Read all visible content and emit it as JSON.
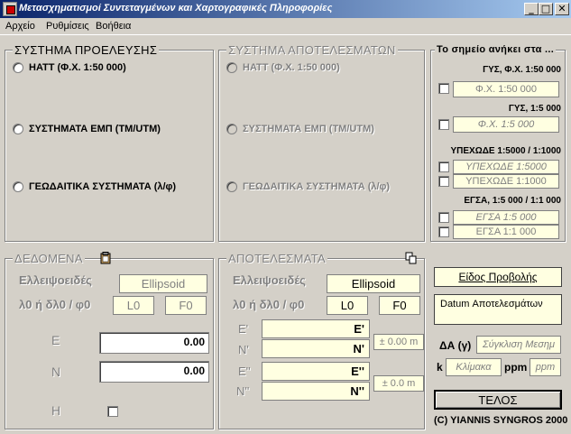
{
  "window": {
    "title": "Μετασχηματισμοί Συντεταγμένων και Χαρτογραφικές Πληροφορίες",
    "minimize": "_",
    "maximize": "□",
    "close": "✕"
  },
  "menu": [
    "Αρχείο",
    "Ρυθμίσεις",
    "Βοήθεια"
  ],
  "source_system": {
    "title": "ΣΥΣΤΗΜΑ ΠΡΟΕΛΕΥΣΗΣ",
    "options": [
      "ΗΑΤΤ (Φ.Χ. 1:50 000)",
      "ΣΥΣΤΗΜΑΤΑ ΕΜΠ (ΤΜ/UTM)",
      "ΓΕΩΔΑΙΤΙΚΑ ΣΥΣΤΗΜΑΤΑ (λ/φ)"
    ]
  },
  "result_system": {
    "title": "ΣΥΣΤΗΜΑ ΑΠΟΤΕΛΕΣΜΑΤΩΝ",
    "options": [
      "ΗΑΤΤ (Φ.Χ. 1:50 000)",
      "ΣΥΣΤΗΜΑΤΑ ΕΜΠ (ΤΜ/UTM)",
      "ΓΕΩΔΑΙΤΙΚΑ ΣΥΣΤΗΜΑΤΑ (λ/φ)"
    ]
  },
  "point_belongs": {
    "title": "Το σημείο ανήκει στα ...",
    "gys_50000_label": "ΓΥΣ, Φ.Χ. 1:50 000",
    "gys_50000_box": "Φ.Χ. 1:50 000",
    "gys_5000_label": "ΓΥΣ, 1:5 000",
    "gys_5000_box": "Φ.Χ. 1:5 000",
    "yphexode_label": "ΥΠΕΧΩΔΕ 1:5000 / 1:1000",
    "yphexode_box1": "ΥΠΕΧΩΔΕ 1:5000",
    "yphexode_box2": "ΥΠΕΧΩΔΕ 1:1000",
    "egsa_label": "ΕΓΣΑ, 1:5 000 / 1:1 000",
    "egsa_box1": "ΕΓΣΑ 1:5 000",
    "egsa_box2": "ΕΓΣΑ 1:1 000"
  },
  "data": {
    "title": "ΔΕΔΟΜΕΝΑ",
    "ellipsoid_label": "Ελλειψοειδές",
    "ellipsoid_value": "Ellipsoid",
    "lambda_label": "λ0 ή δλ0 / φ0",
    "l0": "L0",
    "f0": "F0",
    "e_label": "Ε",
    "e_value": "0.00",
    "n_label": "Ν",
    "n_value": "0.00",
    "h_label": "Η"
  },
  "results": {
    "title": "ΑΠΟΤΕΛΕΣΜΑΤΑ",
    "ellipsoid_label": "Ελλειψοειδές",
    "ellipsoid_value": "Ellipsoid",
    "lambda_label": "λ0 ή δλ0 / φ0",
    "l0": "L0",
    "f0": "F0",
    "e1_label": "Ε'",
    "e1_value": "Ε'",
    "n1_label": "Ν'",
    "n1_value": "Ν'",
    "pm1": "± 0.00 m",
    "e2_label": "Ε''",
    "e2_value": "Ε''",
    "n2_label": "Ν''",
    "n2_value": "Ν''",
    "pm2": "± 0.0 m"
  },
  "projection": {
    "type_label": "Είδος Προβολής",
    "datum_label": "Datum Αποτελεσμάτων",
    "delta_a_label": "ΔΑ (γ)",
    "convergence": "Σύγκλιση Μεσημ",
    "k_label": "k",
    "scale": "Κλίμακα",
    "ppm_label": "ppm",
    "ppm_value": "ppm"
  },
  "exit_button": "ΤΕΛΟΣ",
  "copyright": "(C) YIANNIS SYNGROS 2000"
}
